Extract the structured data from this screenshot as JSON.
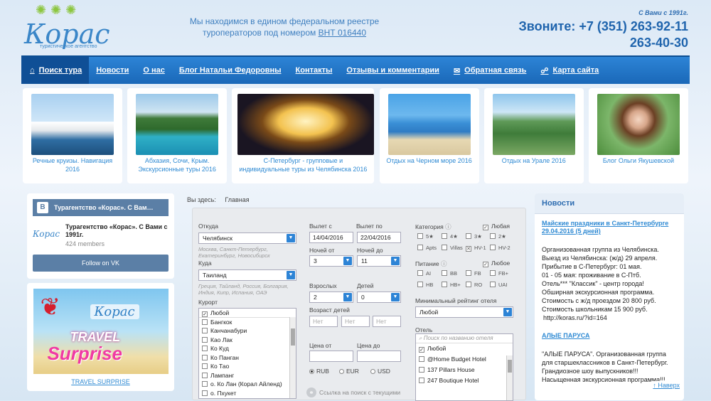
{
  "header": {
    "logo_text": "Корас",
    "logo_sub": "туристическое агентство",
    "reestr_line1": "Мы находимся в едином федеральном реестре",
    "reestr_line2": "туроператоров под номером",
    "reestr_number": "ВНТ 016440",
    "since": "С Вами с 1991г.",
    "phone1": "Звоните: +7 (351) 263-92-11",
    "phone2": "263-40-30"
  },
  "nav": [
    {
      "label": "Поиск тура",
      "icon": "home-icon",
      "active": true
    },
    {
      "label": "Новости"
    },
    {
      "label": "О нас"
    },
    {
      "label": "Блог Натальи Федоровны"
    },
    {
      "label": "Контакты"
    },
    {
      "label": "Отзывы и комментарии"
    },
    {
      "label": "Обратная связь",
      "icon": "envelope-icon"
    },
    {
      "label": "Карта сайта",
      "icon": "sitemap-icon"
    }
  ],
  "tiles": [
    {
      "caption": "Речные круизы. Навигация 2016"
    },
    {
      "caption": "Абхазия, Сочи, Крым. Экскурсионные туры 2016"
    },
    {
      "caption": "С-Петербург - групповые и индивидуальные туры из Челябинска 2016"
    },
    {
      "caption": "Отдых на Черном море 2016"
    },
    {
      "caption": "Отдых на Урале 2016"
    },
    {
      "caption": "Блог Ольги Якушевской"
    }
  ],
  "vk": {
    "header": "Турагентство «Корас». С Вам…",
    "avatar_text": "Корас",
    "group_name": "Турагентство «Корас». С Вами с 1991г.",
    "members": "424 members",
    "follow": "Follow on VK"
  },
  "promo": {
    "logo": "Корас",
    "text1": "TRAVEL",
    "text2": "Surprise",
    "link": "TRAVEL SURPRISE"
  },
  "breadcrumb": {
    "label": "Вы здесь:",
    "current": "Главная"
  },
  "search": {
    "from_label": "Откуда",
    "from_value": "Челябинск",
    "from_hint": "Москва, Санкт-Петербург, Екатеринбург, Новосибирск",
    "to_label": "Куда",
    "to_value": "Таиланд",
    "to_hint": "Греция, Тайланд, Россия, Болгария, Индия, Кипр, Испания, ОАЭ",
    "resort_label": "Курорт",
    "resorts": [
      "Любой",
      "Бангкок",
      "Канчанабури",
      "Као Лак",
      "Ко Куд",
      "Ко Панган",
      "Ко Тао",
      "Лампанг",
      "о. Ко Лан (Корал Айленд)",
      "о. Пхукет"
    ],
    "date_from_label": "Вылет с",
    "date_from": "14/04/2016",
    "date_to_label": "Вылет по",
    "date_to": "22/04/2016",
    "nights_from_label": "Ночей от",
    "nights_from": "3",
    "nights_to_label": "Ночей до",
    "nights_to": "11",
    "adults_label": "Взрослых",
    "adults": "2",
    "children_label": "Детей",
    "children": "0",
    "child_age_label": "Возраст детей",
    "age_placeholder": "Нет",
    "price_from_label": "Цена от",
    "price_to_label": "Цена до",
    "currencies": [
      "RUB",
      "EUR",
      "USD"
    ],
    "link_text": "Ссылка на поиск с текущими",
    "category_label": "Категория",
    "any_label": "Любая",
    "categories": [
      "5★",
      "4★",
      "3★",
      "2★",
      "Apts",
      "Villas",
      "HV-1",
      "HV-2"
    ],
    "meal_label": "Питание",
    "meal_any": "Любое",
    "meals": [
      "AI",
      "BB",
      "FB",
      "FB+",
      "HB",
      "HB+",
      "RO",
      "UAI"
    ],
    "rating_label": "Минимальный рейтинг отеля",
    "rating_value": "Любой",
    "hotel_label": "Отель",
    "hotel_placeholder": "Поиск по названию отеля",
    "hotels": [
      "Любой",
      "@Home Budget Hotel",
      "137 Pillars House",
      "247 Boutique Hotel"
    ]
  },
  "news": {
    "title": "Новости",
    "item1_title": "Майские праздники в Санкт-Петербурге",
    "item1_date": "29.04.2016 (5 дней)",
    "item1_lines": [
      "Организованная группа из Челябинска.",
      "Выезд из Челябинска: (ж/д) 29 апреля.",
      "Прибытие в С-Петербург: 01 мая.",
      "01 - 05 мая: проживание в С-Птб.",
      "Отель*** \"Классик\" - центр города!",
      "Обширная экскурсионная программа.",
      "Стоимость с ж/д проездом 20 800 руб.",
      "Стоимость школьникам 15 900 руб.",
      "http://koras.ru/?id=164"
    ],
    "item2_title": "АЛЫЕ ПАРУСА",
    "item2_lines": [
      "\"АЛЫЕ ПАРУСА\". Организованная группа для старшеклассников в Санкт-Петербург.",
      "Грандиозное шоу выпускников!!!",
      "Насыщенная экскурсионная программа!!!"
    ]
  },
  "back_to_top": "↑ Наверх"
}
